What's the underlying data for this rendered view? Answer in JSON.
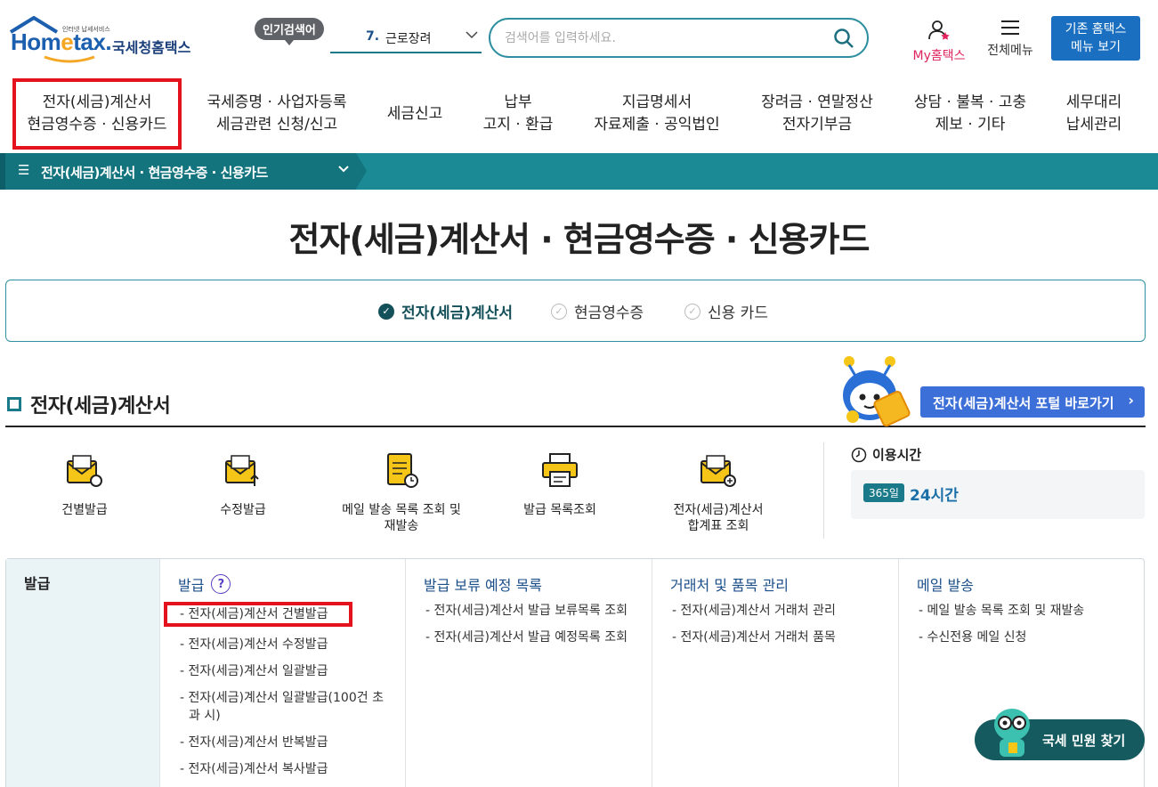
{
  "header": {
    "logo_small": "인터넷 납세서비스",
    "logo_word_a": "Hom",
    "logo_word_e": "e",
    "logo_word_b": "tax.",
    "logo_kr": "국세청홈택스",
    "popular_badge": "인기검색어",
    "popular_num": "7.",
    "popular_text": "근로장려",
    "search_placeholder": "검색어를 입력하세요.",
    "my_home": "My홈택스",
    "all_menu": "전체메뉴",
    "old_menu_line1": "기존 홈택스",
    "old_menu_line2": "메뉴 보기"
  },
  "nav": [
    {
      "l1": "전자(세금)계산서",
      "l2": "현금영수증 · 신용카드"
    },
    {
      "l1": "국세증명 · 사업자등록",
      "l2": "세금관련 신청/신고"
    },
    {
      "l1": "세금신고",
      "l2": ""
    },
    {
      "l1": "납부",
      "l2": "고지 · 환급"
    },
    {
      "l1": "지급명세서",
      "l2": "자료제출 · 공익법인"
    },
    {
      "l1": "장려금 · 연말정산",
      "l2": "전자기부금"
    },
    {
      "l1": "상담 · 불복 · 고충",
      "l2": "제보 · 기타"
    },
    {
      "l1": "세무대리",
      "l2": "납세관리"
    }
  ],
  "breadcrumb": "전자(세금)계산서 · 현금영수증 · 신용카드",
  "page_title": "전자(세금)계산서 · 현금영수증 · 신용카드",
  "tabs": [
    "전자(세금)계산서",
    "현금영수증",
    "신용 카드"
  ],
  "section": {
    "title": "전자(세금)계산서",
    "portal_button": "전자(세금)계산서 포털 바로가기"
  },
  "quick": [
    {
      "label": "건별발급"
    },
    {
      "label": "수정발급"
    },
    {
      "label": "메일 발송 목록 조회 및\n재발송"
    },
    {
      "label": "발급 목록조회"
    },
    {
      "label": "전자(세금)계산서\n합계표 조회"
    }
  ],
  "usage": {
    "title": "이용시간",
    "badge": "365일",
    "value": "24시간"
  },
  "menu": {
    "category": "발급",
    "columns": [
      {
        "head": "발급",
        "items": [
          "- 전자(세금)계산서 건별발급",
          "- 전자(세금)계산서 수정발급",
          "- 전자(세금)계산서 일괄발급",
          "- 전자(세금)계산서 일괄발급(100건 초과 시)",
          "- 전자(세금)계산서 반복발급",
          "- 전자(세금)계산서 복사발급"
        ]
      },
      {
        "head": "발급 보류 예정 목록",
        "items": [
          "- 전자(세금)계산서 발급 보류목록 조회",
          "- 전자(세금)계산서 발급 예정목록 조회"
        ]
      },
      {
        "head": "거래처 및 품목 관리",
        "items": [
          "- 전자(세금)계산서 거래처 관리",
          "- 전자(세금)계산서 거래처 품목"
        ]
      },
      {
        "head": "메일 발송",
        "items": [
          "- 메일 발송 목록 조회 및 재발송",
          "- 수신전용 메일 신청"
        ]
      }
    ]
  },
  "chat_button": "국세 민원 찾기",
  "colors": {
    "teal": "#1b8a94",
    "highlight": "#e3121c",
    "blue_btn": "#3d6fd8"
  }
}
